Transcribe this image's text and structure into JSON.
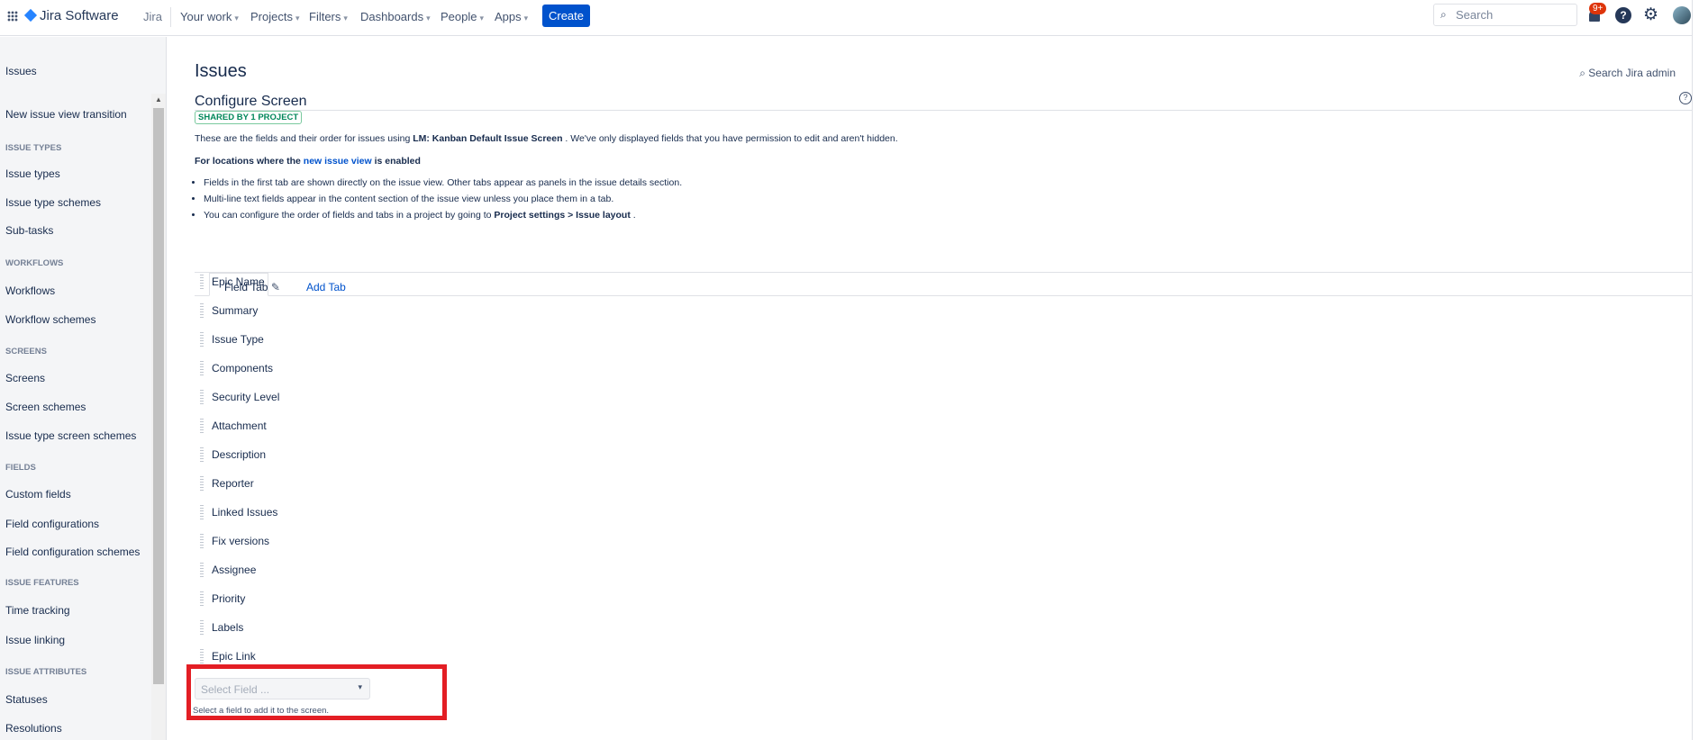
{
  "topbar": {
    "product": "Jira Software",
    "site": "Jira",
    "nav": [
      "Your work",
      "Projects",
      "Filters",
      "Dashboards",
      "People",
      "Apps"
    ],
    "create": "Create",
    "search_placeholder": "Search",
    "notif_badge": "9+"
  },
  "sidebar": {
    "items": [
      {
        "type": "link",
        "label": "Issues"
      },
      {
        "type": "link",
        "label": "New issue view transition"
      },
      {
        "type": "head",
        "label": "ISSUE TYPES"
      },
      {
        "type": "link",
        "label": "Issue types"
      },
      {
        "type": "link",
        "label": "Issue type schemes"
      },
      {
        "type": "link",
        "label": "Sub-tasks"
      },
      {
        "type": "head",
        "label": "WORKFLOWS"
      },
      {
        "type": "link",
        "label": "Workflows"
      },
      {
        "type": "link",
        "label": "Workflow schemes"
      },
      {
        "type": "head",
        "label": "SCREENS"
      },
      {
        "type": "link",
        "label": "Screens"
      },
      {
        "type": "link",
        "label": "Screen schemes"
      },
      {
        "type": "link",
        "label": "Issue type screen schemes"
      },
      {
        "type": "head",
        "label": "FIELDS"
      },
      {
        "type": "link",
        "label": "Custom fields"
      },
      {
        "type": "link",
        "label": "Field configurations"
      },
      {
        "type": "link",
        "label": "Field configuration schemes"
      },
      {
        "type": "head",
        "label": "ISSUE FEATURES"
      },
      {
        "type": "link",
        "label": "Time tracking"
      },
      {
        "type": "link",
        "label": "Issue linking"
      },
      {
        "type": "head",
        "label": "ISSUE ATTRIBUTES"
      },
      {
        "type": "link",
        "label": "Statuses"
      },
      {
        "type": "link",
        "label": "Resolutions"
      }
    ]
  },
  "main": {
    "title": "Issues",
    "search_admin": "Search Jira admin",
    "subtitle": "Configure Screen",
    "badge": "SHARED BY 1 PROJECT",
    "desc_pre": "These are the fields and their order for issues using ",
    "desc_bold": "LM: Kanban Default Issue Screen",
    "desc_post": " . We've only displayed fields that you have permission to edit and aren't hidden.",
    "loc_pre": "For locations where the ",
    "loc_link": "new issue view",
    "loc_post": " is enabled",
    "bullets": [
      "Fields in the first tab are shown directly on the issue view. Other tabs appear as panels in the issue details section.",
      "Multi-line text fields appear in the content section of the issue view unless you place them in a tab."
    ],
    "b3_pre": "You can configure the order of fields and tabs in a project by going to ",
    "b3_bold": "Project settings > Issue layout",
    "b3_post": " .",
    "tabs": {
      "active": "Field Tab",
      "add": "Add Tab"
    },
    "fields": [
      "Epic Name",
      "Summary",
      "Issue Type",
      "Components",
      "Security Level",
      "Attachment",
      "Description",
      "Reporter",
      "Linked Issues",
      "Fix versions",
      "Assignee",
      "Priority",
      "Labels",
      "Epic Link"
    ],
    "select_placeholder": "Select Field ...",
    "select_hint": "Select a field to add it to the screen."
  },
  "colors": {
    "accent": "#0052cc",
    "highlight": "#e31e24",
    "badge": "#00875a"
  }
}
